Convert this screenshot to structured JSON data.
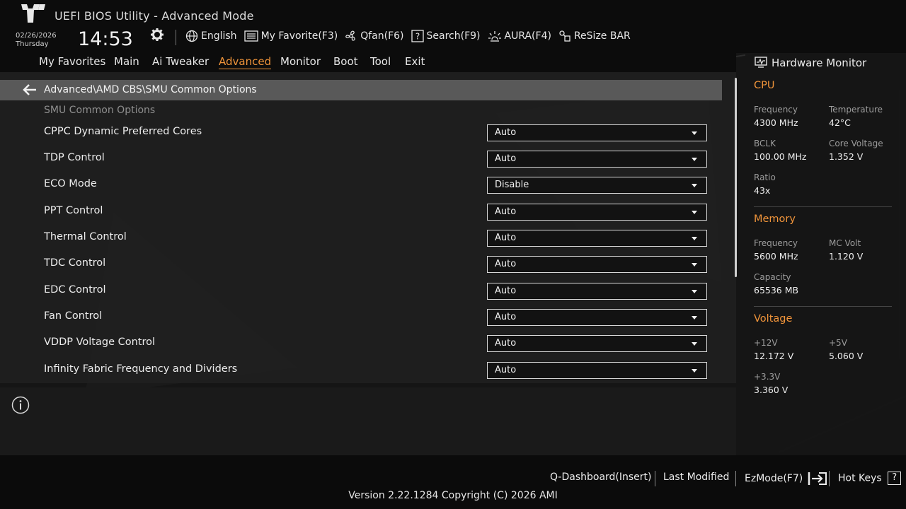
{
  "header": {
    "title": "UEFI BIOS Utility - Advanced Mode",
    "date": "02/26/2026",
    "day": "Thursday",
    "time": "14:53",
    "toolbar": {
      "language": "English",
      "favorite": "My Favorite(F3)",
      "qfan": "Qfan(F6)",
      "search": "Search(F9)",
      "aura": "AURA(F4)",
      "resize_bar": "ReSize BAR"
    }
  },
  "tabs": [
    "My Favorites",
    "Main",
    "Ai Tweaker",
    "Advanced",
    "Monitor",
    "Boot",
    "Tool",
    "Exit"
  ],
  "active_tab": "Advanced",
  "breadcrumb": "Advanced\\AMD CBS\\SMU Common Options",
  "section_title": "SMU Common Options",
  "settings": [
    {
      "label": "CPPC Dynamic Preferred Cores",
      "value": "Auto"
    },
    {
      "label": "TDP Control",
      "value": "Auto"
    },
    {
      "label": "ECO Mode",
      "value": "Disable"
    },
    {
      "label": "PPT Control",
      "value": "Auto"
    },
    {
      "label": "Thermal Control",
      "value": "Auto"
    },
    {
      "label": "TDC Control",
      "value": "Auto"
    },
    {
      "label": "EDC Control",
      "value": "Auto"
    },
    {
      "label": "Fan Control",
      "value": "Auto"
    },
    {
      "label": "VDDP Voltage Control",
      "value": "Auto"
    },
    {
      "label": "Infinity Fabric Frequency and Dividers",
      "value": "Auto"
    }
  ],
  "hardware_monitor": {
    "title": "Hardware Monitor",
    "cpu": {
      "heading": "CPU",
      "frequency_label": "Frequency",
      "frequency": "4300 MHz",
      "temperature_label": "Temperature",
      "temperature": "42°C",
      "bclk_label": "BCLK",
      "bclk": "100.00 MHz",
      "core_voltage_label": "Core Voltage",
      "core_voltage": "1.352 V",
      "ratio_label": "Ratio",
      "ratio": "43x"
    },
    "memory": {
      "heading": "Memory",
      "frequency_label": "Frequency",
      "frequency": "5600 MHz",
      "mc_volt_label": "MC Volt",
      "mc_volt": "1.120 V",
      "capacity_label": "Capacity",
      "capacity": "65536 MB"
    },
    "voltage": {
      "heading": "Voltage",
      "v12_label": "+12V",
      "v12": "12.172 V",
      "v5_label": "+5V",
      "v5": "5.060 V",
      "v33_label": "+3.3V",
      "v33": "3.360 V"
    }
  },
  "footer": {
    "qdashboard": "Q-Dashboard(Insert)",
    "last_modified": "Last Modified",
    "ezmode": "EzMode(F7)",
    "hotkeys": "Hot Keys",
    "hotkeys_icon_text": "?",
    "version": "Version 2.22.1284 Copyright (C) 2026 AMI"
  },
  "colors": {
    "accent": "#f0943a",
    "background": "#151515",
    "breadcrumb_bar": "#595959"
  }
}
